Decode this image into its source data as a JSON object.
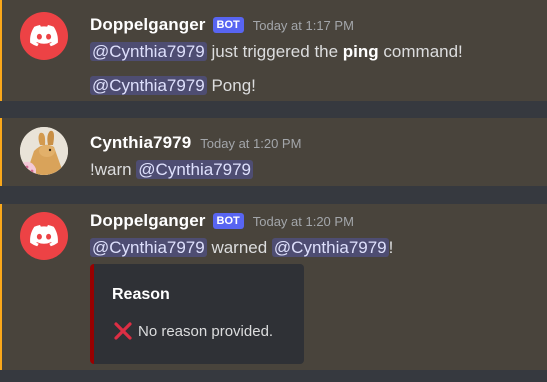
{
  "messages": [
    {
      "author": "Doppelganger",
      "tag": "BOT",
      "time": "Today at 1:17 PM",
      "lines": [
        {
          "mention": "@Cynthia7979",
          "text_before_bold": " just triggered the ",
          "bold": "ping",
          "text_after": " command!"
        },
        {
          "mention": "@Cynthia7979",
          "text": " Pong!"
        }
      ]
    },
    {
      "author": "Cynthia7979",
      "time": "Today at 1:20 PM",
      "lines": [
        {
          "prefix": "!warn ",
          "mention": "@Cynthia7979"
        }
      ]
    },
    {
      "author": "Doppelganger",
      "tag": "BOT",
      "time": "Today at 1:20 PM",
      "lines": [
        {
          "mention": "@Cynthia7979",
          "middle": " warned ",
          "mention2": "@Cynthia7979",
          "suffix": "!"
        }
      ],
      "embed": {
        "title": "Reason",
        "icon": "cross-mark-icon",
        "description": "No reason provided.",
        "color": "#990000"
      }
    }
  ],
  "colors": {
    "highlight_bg": "#49443c",
    "highlight_border": "#faa81a",
    "bot_avatar": "#ed4245",
    "bot_tag": "#5865f2"
  }
}
